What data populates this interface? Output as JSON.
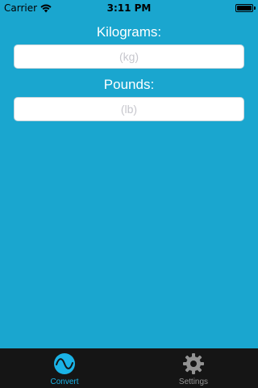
{
  "status_bar": {
    "carrier": "Carrier",
    "time": "3:11 PM",
    "wifi_icon": "wifi-icon",
    "battery_icon": "battery-icon"
  },
  "form": {
    "kilograms_label": "Kilograms:",
    "kilograms_placeholder": "(kg)",
    "kilograms_value": "",
    "pounds_label": "Pounds:",
    "pounds_placeholder": "(lb)",
    "pounds_value": ""
  },
  "tab_bar": {
    "tabs": [
      {
        "label": "Convert",
        "icon": "wave-icon",
        "selected": true
      },
      {
        "label": "Settings",
        "icon": "gear-icon",
        "selected": false
      }
    ]
  },
  "colors": {
    "background": "#1aa6cf",
    "tab_bar": "#151515",
    "tab_active": "#1ab3e6",
    "tab_inactive": "#929292"
  }
}
